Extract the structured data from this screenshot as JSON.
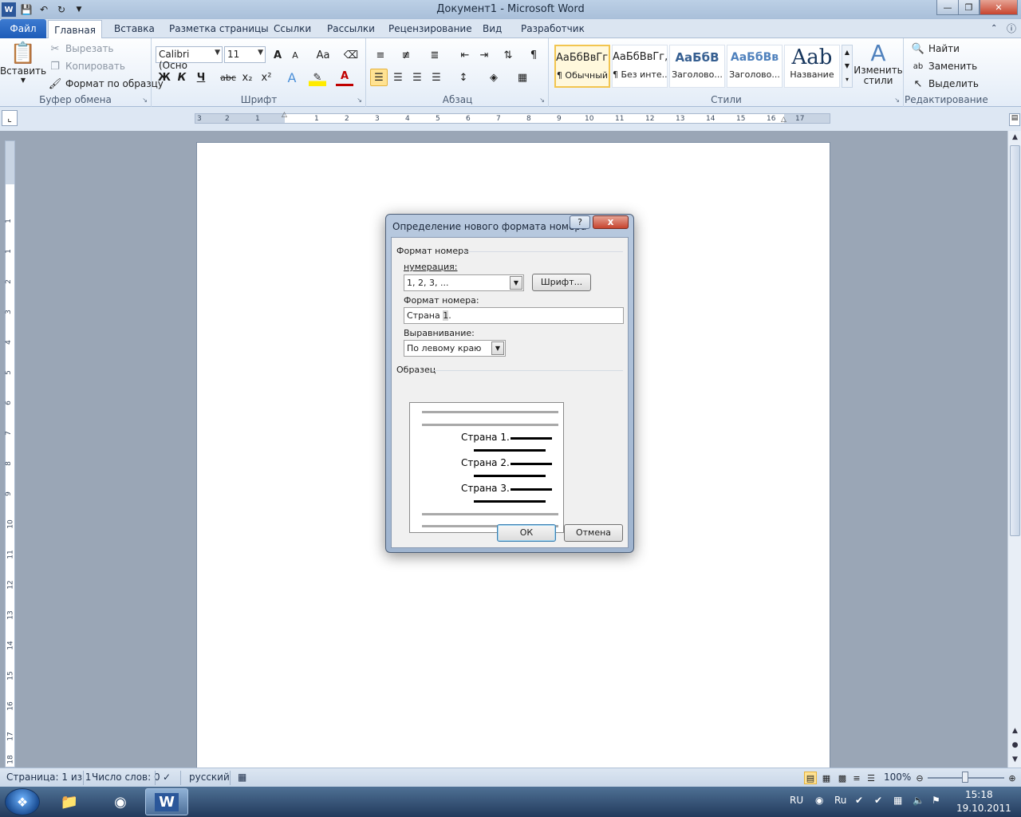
{
  "window": {
    "title": "Документ1  -  Microsoft Word",
    "quick_access": [
      "word-app-icon",
      "save-icon",
      "undo-icon",
      "redo-icon",
      "customize-icon"
    ]
  },
  "tabs": [
    {
      "label": "Файл"
    },
    {
      "label": "Главная"
    },
    {
      "label": "Вставка"
    },
    {
      "label": "Разметка страницы"
    },
    {
      "label": "Ссылки"
    },
    {
      "label": "Рассылки"
    },
    {
      "label": "Рецензирование"
    },
    {
      "label": "Вид"
    },
    {
      "label": "Разработчик"
    }
  ],
  "ribbon": {
    "clipboard": {
      "paste_label": "Вставить",
      "cut_label": "Вырезать",
      "copy_label": "Копировать",
      "format_painter_label": "Формат по образцу",
      "group_label": "Буфер обмена"
    },
    "font": {
      "font_name": "Calibri (Осно",
      "font_size": "11",
      "bold": "Ж",
      "italic": "К",
      "underline": "Ч",
      "strike": "abc",
      "subscript": "x₂",
      "superscript": "x²",
      "grow": "A",
      "shrink": "A",
      "case": "Aa",
      "group_label": "Шрифт"
    },
    "paragraph": {
      "group_label": "Абзац"
    },
    "styles": {
      "items": [
        {
          "preview": "АаБбВвГг,",
          "name": "¶ Обычный"
        },
        {
          "preview": "АаБбВвГг,",
          "name": "¶ Без инте..."
        },
        {
          "preview": "АаБбВ",
          "name": "Заголово..."
        },
        {
          "preview": "АаБбВв",
          "name": "Заголово..."
        },
        {
          "preview": "Aab",
          "name": "Название"
        }
      ],
      "change_styles_label": "Изменить стили",
      "group_label": "Стили"
    },
    "editing": {
      "find_label": "Найти",
      "replace_label": "Заменить",
      "select_label": "Выделить",
      "group_label": "Редактирование"
    }
  },
  "ruler": {
    "h_ticks": [
      "3",
      "2",
      "1",
      "1",
      "2",
      "3",
      "4",
      "5",
      "6",
      "7",
      "8",
      "9",
      "10",
      "11",
      "12",
      "13",
      "14",
      "15",
      "16",
      "17"
    ],
    "v_ticks": [
      "1",
      "1",
      "2",
      "3",
      "4",
      "5",
      "6",
      "7",
      "8",
      "9",
      "10",
      "11",
      "12",
      "13",
      "14",
      "15",
      "16",
      "17",
      "18"
    ]
  },
  "dialog": {
    "title": "Определение нового формата номера",
    "help": "?",
    "close": "x",
    "section_format": "Формат номера",
    "numbering_label": "нумерация:",
    "numbering_value": "1, 2, 3, ...",
    "font_button": "Шрифт...",
    "number_format_label": "Формат номера:",
    "number_format_prefix": "Страна ",
    "number_format_field": "1",
    "number_format_suffix": ".",
    "alignment_label": "Выравнивание:",
    "alignment_value": "По левому краю",
    "section_sample": "Образец",
    "sample_lines": [
      "Страна 1.",
      "Страна 2.",
      "Страна 3."
    ],
    "ok": "ОК",
    "cancel": "Отмена"
  },
  "statusbar": {
    "page": "Страница: 1 из 1",
    "words": "Число слов: 0",
    "language": "русский",
    "zoom": "100%"
  },
  "taskbar": {
    "lang": "RU",
    "time": "15:18",
    "date": "19.10.2011"
  }
}
